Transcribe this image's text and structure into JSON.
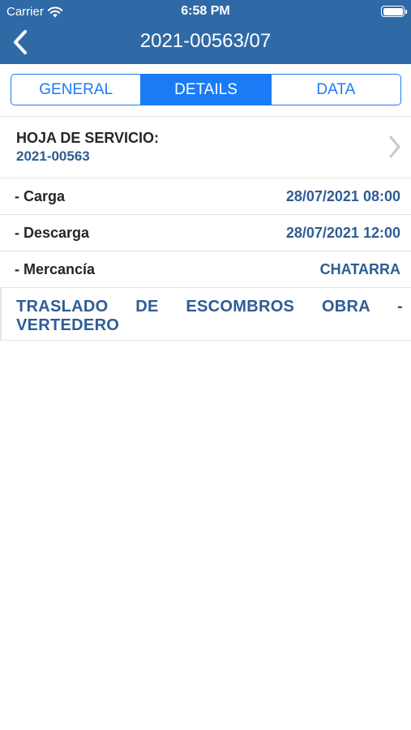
{
  "status_bar": {
    "carrier": "Carrier",
    "time": "6:58 PM",
    "battery_level": 1.0
  },
  "nav": {
    "title": "2021-00563/07",
    "back_icon": "chevron-left-icon"
  },
  "tabs": [
    {
      "label": "GENERAL",
      "active": false
    },
    {
      "label": "DETAILS",
      "active": true
    },
    {
      "label": "DATA",
      "active": false
    }
  ],
  "service": {
    "label": "HOJA DE SERVICIO:",
    "value": "2021-00563"
  },
  "details": [
    {
      "label": "- Carga",
      "value": "28/07/2021 08:00"
    },
    {
      "label": "- Descarga",
      "value": "28/07/2021 12:00"
    },
    {
      "label": "- Mercancía",
      "value": "CHATARRA"
    }
  ],
  "description": "TRASLADO DE ESCOMBROS OBRA - VERTEDERO",
  "colors": {
    "nav_background": "#2f6aa7",
    "accent": "#1a7cf5",
    "value_text": "#2f5c94"
  }
}
